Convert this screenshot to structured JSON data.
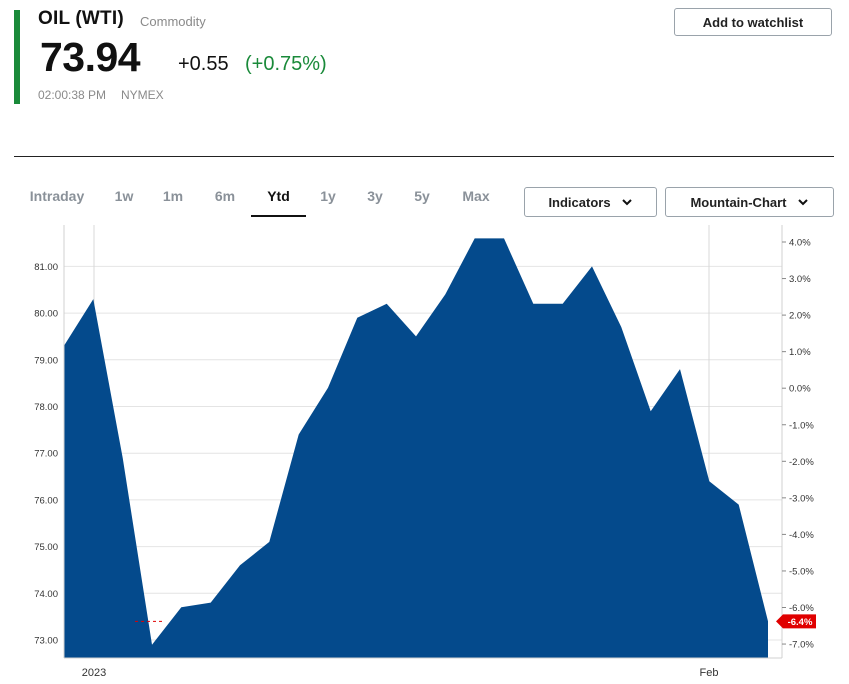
{
  "quote": {
    "symbol": "OIL (WTI)",
    "category": "Commodity",
    "price": "73.94",
    "change": "+0.55",
    "change_pct": "(+0.75%)",
    "time": "02:00:38 PM",
    "exchange": "NYMEX",
    "watchlist_label": "Add to watchlist",
    "up_color": "#1a8a3a"
  },
  "range_tabs": {
    "items": [
      "Intraday",
      "1w",
      "1m",
      "6m",
      "Ytd",
      "1y",
      "3y",
      "5y",
      "Max"
    ],
    "active": "Ytd"
  },
  "controls": {
    "indicators_label": "Indicators",
    "chart_type_label": "Mountain-Chart"
  },
  "chart_data": {
    "type": "area",
    "title": "",
    "xlabel": "",
    "ylabel": "",
    "series": [
      {
        "values": [
          79.3,
          80.3,
          76.9,
          72.9,
          73.7,
          73.8,
          74.6,
          75.1,
          77.4,
          78.4,
          79.9,
          80.2,
          79.5,
          80.4,
          81.6,
          81.6,
          80.2,
          80.2,
          81.0,
          79.7,
          77.9,
          78.8,
          76.4,
          75.9,
          73.4
        ],
        "color": "#044a8c"
      }
    ],
    "ylim": [
      72.7,
      81.9
    ],
    "y_ticks": [
      "73.00",
      "74.00",
      "75.00",
      "76.00",
      "77.00",
      "78.00",
      "79.00",
      "80.00",
      "81.00"
    ],
    "y2_ticks": [
      "4.0%",
      "3.0%",
      "2.0%",
      "1.0%",
      "0.0%",
      "-1.0%",
      "-2.0%",
      "-3.0%",
      "-4.0%",
      "-5.0%",
      "-6.0%",
      "-7.0%"
    ],
    "x_ticks": [
      "2023",
      "Feb"
    ],
    "last_change_badge": "-6.4%",
    "badge_color": "#e00000",
    "grid": true
  }
}
